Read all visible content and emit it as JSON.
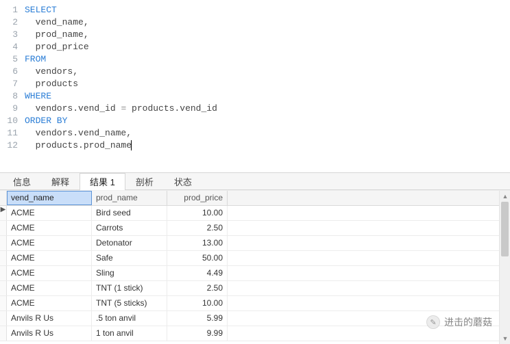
{
  "sql": {
    "lines": [
      {
        "n": "1",
        "indent": "",
        "kw": "SELECT",
        "rest": ""
      },
      {
        "n": "2",
        "indent": "  ",
        "kw": "",
        "rest": "vend_name,"
      },
      {
        "n": "3",
        "indent": "  ",
        "kw": "",
        "rest": "prod_name,"
      },
      {
        "n": "4",
        "indent": "  ",
        "kw": "",
        "rest": "prod_price"
      },
      {
        "n": "5",
        "indent": "",
        "kw": "FROM",
        "rest": ""
      },
      {
        "n": "6",
        "indent": "  ",
        "kw": "",
        "rest": "vendors,"
      },
      {
        "n": "7",
        "indent": "  ",
        "kw": "",
        "rest": "products"
      },
      {
        "n": "8",
        "indent": "",
        "kw": "WHERE",
        "rest": ""
      },
      {
        "n": "9",
        "indent": "  ",
        "kw": "",
        "rest": "vendors.vend_id = products.vend_id"
      },
      {
        "n": "10",
        "indent": "",
        "kw": "ORDER BY",
        "rest": ""
      },
      {
        "n": "11",
        "indent": "  ",
        "kw": "",
        "rest": "vendors.vend_name,"
      },
      {
        "n": "12",
        "indent": "  ",
        "kw": "",
        "rest": "products.prod_name"
      }
    ],
    "cursor_line": 12
  },
  "tabs": {
    "items": [
      {
        "label": "信息",
        "active": false
      },
      {
        "label": "解释",
        "active": false
      },
      {
        "label": "结果 1",
        "active": true
      },
      {
        "label": "剖析",
        "active": false
      },
      {
        "label": "状态",
        "active": false
      }
    ]
  },
  "grid": {
    "columns": [
      {
        "label": "vend_name",
        "selected": true
      },
      {
        "label": "prod_name",
        "selected": false
      },
      {
        "label": "prod_price",
        "selected": false
      }
    ],
    "current_row": 0,
    "rows": [
      {
        "vend_name": "ACME",
        "prod_name": "Bird seed",
        "prod_price": "10.00"
      },
      {
        "vend_name": "ACME",
        "prod_name": "Carrots",
        "prod_price": "2.50"
      },
      {
        "vend_name": "ACME",
        "prod_name": "Detonator",
        "prod_price": "13.00"
      },
      {
        "vend_name": "ACME",
        "prod_name": "Safe",
        "prod_price": "50.00"
      },
      {
        "vend_name": "ACME",
        "prod_name": "Sling",
        "prod_price": "4.49"
      },
      {
        "vend_name": "ACME",
        "prod_name": "TNT (1 stick)",
        "prod_price": "2.50"
      },
      {
        "vend_name": "ACME",
        "prod_name": "TNT (5 sticks)",
        "prod_price": "10.00"
      },
      {
        "vend_name": "Anvils R Us",
        "prod_name": ".5 ton anvil",
        "prod_price": "5.99"
      },
      {
        "vend_name": "Anvils R Us",
        "prod_name": "1 ton anvil",
        "prod_price": "9.99"
      }
    ]
  },
  "watermark": {
    "icon": "wechat-icon",
    "text": "进击的蘑菇"
  }
}
